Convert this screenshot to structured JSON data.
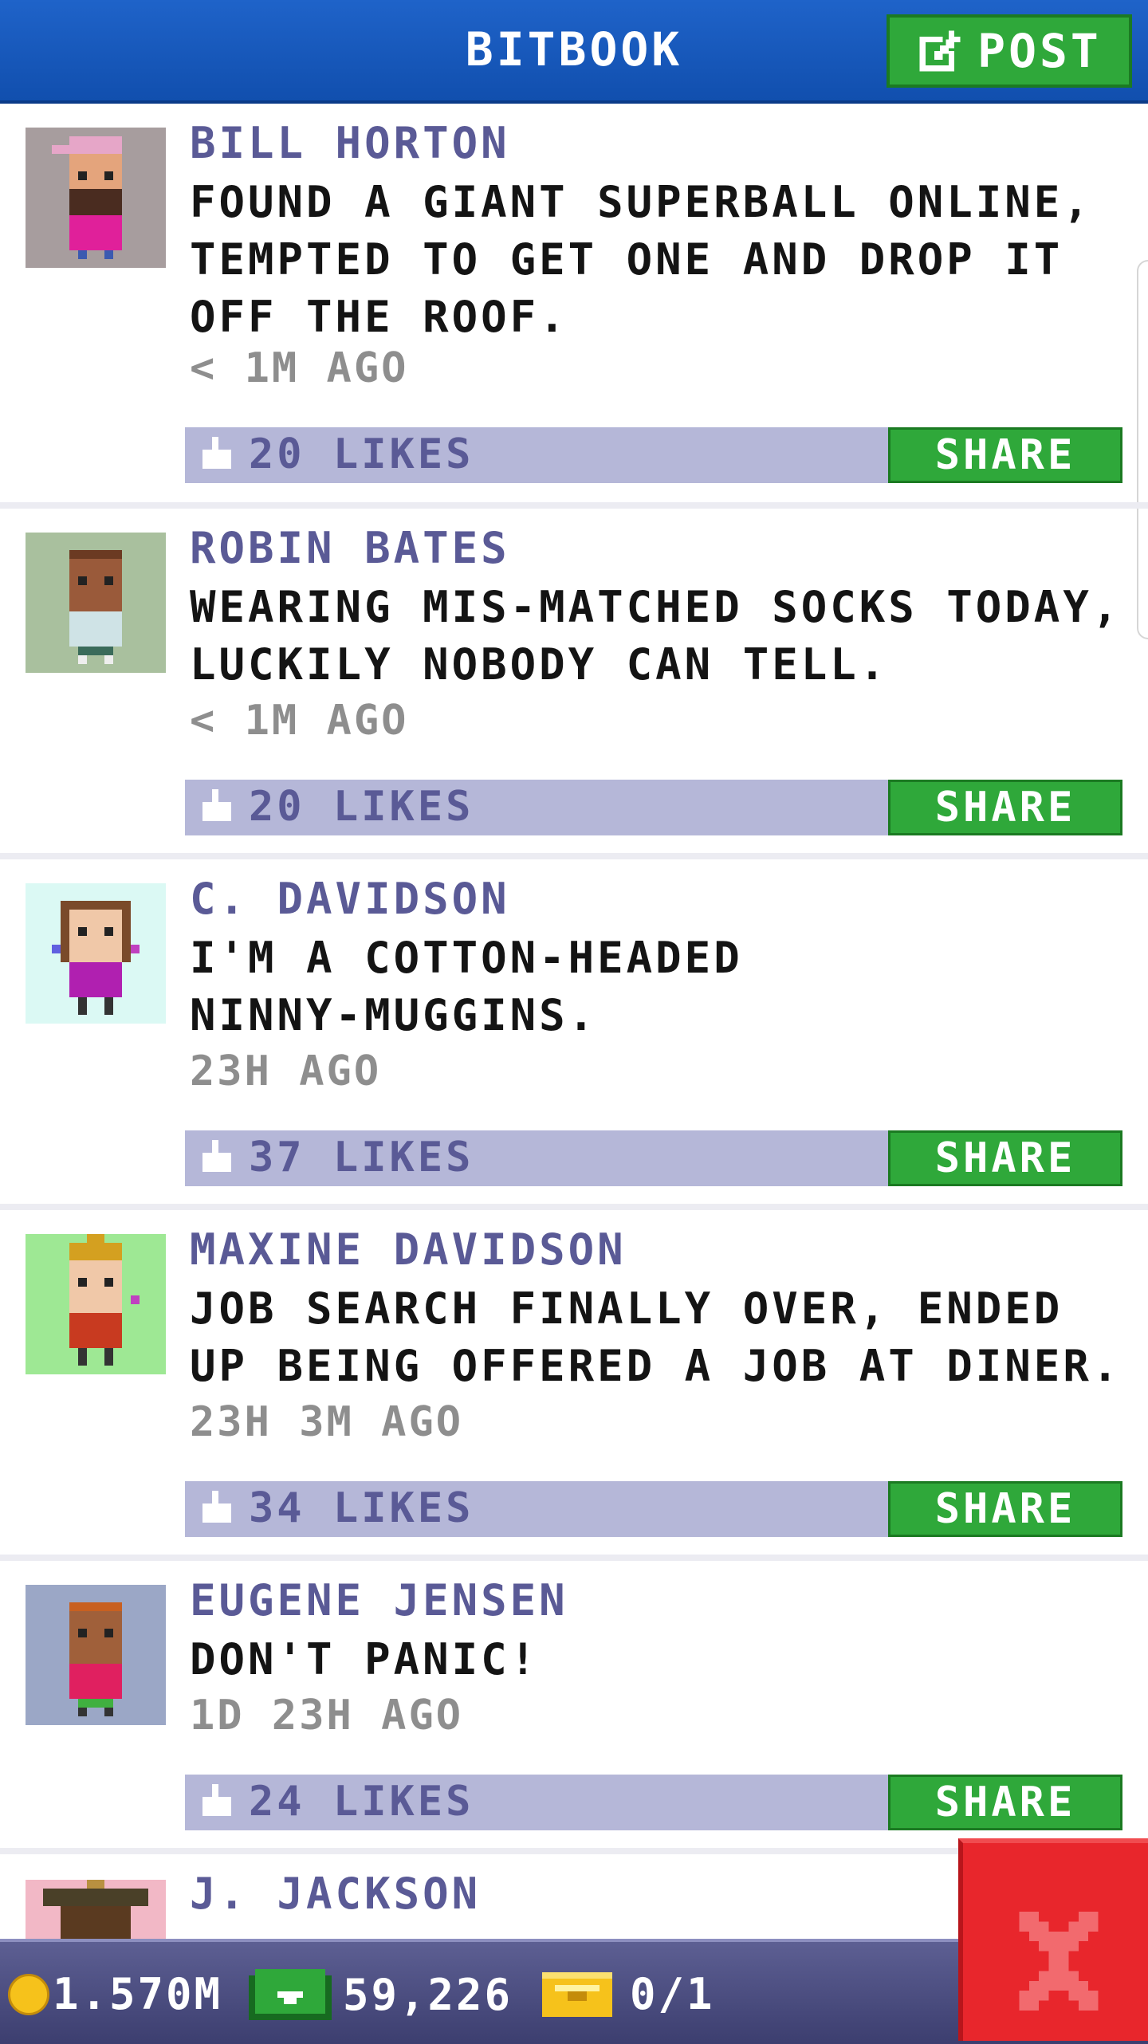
{
  "header": {
    "title": "BITBOOK",
    "post_label": "POST"
  },
  "posts": [
    {
      "author": "BILL HORTON",
      "text": "FOUND A GIANT SUPERBALL ONLINE, TEMPTED TO GET ONE AND DROP IT OFF THE ROOF.",
      "time": "< 1M AGO",
      "likes": "20 LIKES",
      "share": "SHARE",
      "avatar_bg": "#a79d9e"
    },
    {
      "author": "ROBIN BATES",
      "text": "WEARING MIS-MATCHED SOCKS TODAY, LUCKILY NOBODY CAN TELL.",
      "time": "< 1M AGO",
      "likes": "20 LIKES",
      "share": "SHARE",
      "avatar_bg": "#a9c09e"
    },
    {
      "author": "C. DAVIDSON",
      "text": "I'M A COTTON-HEADED NINNY-MUGGINS.",
      "time": "23H AGO",
      "likes": "37 LIKES",
      "share": "SHARE",
      "avatar_bg": "#dbf9f4"
    },
    {
      "author": "MAXINE DAVIDSON",
      "text": "JOB SEARCH FINALLY OVER, ENDED UP BEING OFFERED A JOB AT DINER.",
      "time": "23H 3M AGO",
      "likes": "34 LIKES",
      "share": "SHARE",
      "avatar_bg": "#9ee894"
    },
    {
      "author": "EUGENE JENSEN",
      "text": "DON'T PANIC!",
      "time": "1D 23H AGO",
      "likes": "24 LIKES",
      "share": "SHARE",
      "avatar_bg": "#9ba7c6"
    }
  ],
  "partial_post": {
    "author": "J. JACKSON",
    "avatar_bg": "#f2b8c6"
  },
  "status_bar": {
    "coins": "1.570M",
    "bux": "59,226",
    "tickets": "0/1"
  },
  "colors": {
    "header": "#1a5bbf",
    "accent_green": "#2fa83a",
    "likes_bar": "#b5b7d8",
    "author_text": "#5a5a96",
    "close_red": "#e8262c"
  }
}
